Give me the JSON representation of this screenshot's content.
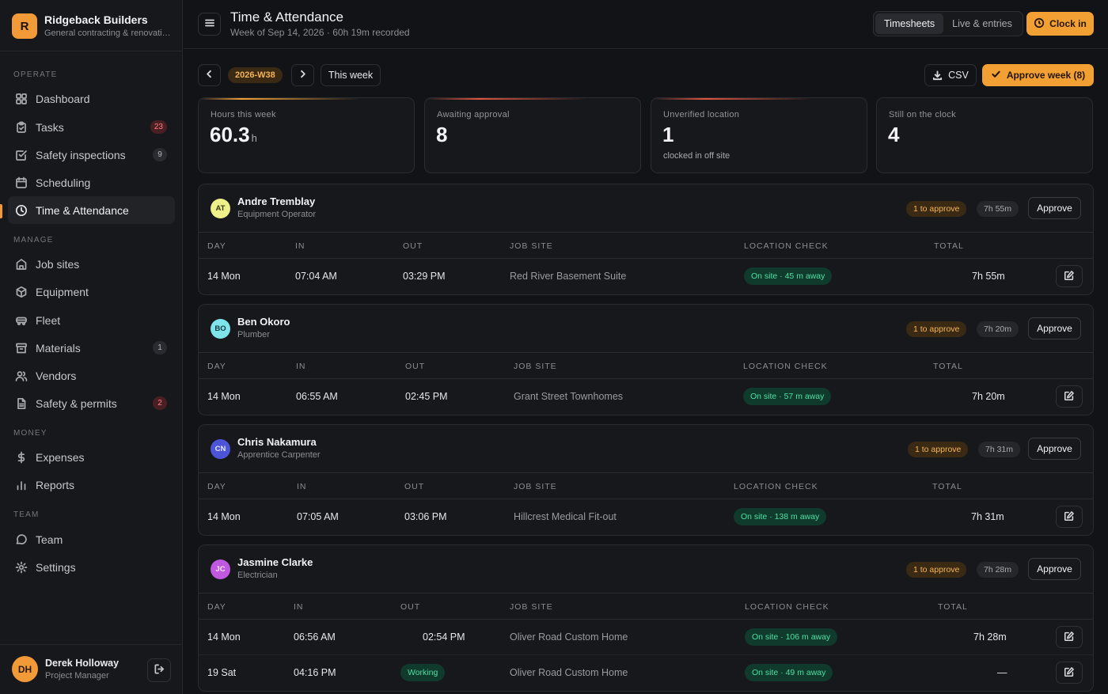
{
  "brand": {
    "logo_letter": "R",
    "name": "Ridgeback Builders",
    "subtitle": "General contracting & renovation"
  },
  "sidebar": {
    "sections": {
      "operate": "OPERATE",
      "manage": "MANAGE",
      "money": "MONEY",
      "team": "TEAM"
    },
    "items": {
      "dashboard": {
        "label": "Dashboard",
        "icon": "grid-icon"
      },
      "tasks": {
        "label": "Tasks",
        "icon": "clipboard-icon",
        "badge": "23"
      },
      "safety_inspections": {
        "label": "Safety inspections",
        "icon": "checkbox-icon",
        "badge": "9"
      },
      "scheduling": {
        "label": "Scheduling",
        "icon": "calendar-icon"
      },
      "time_attendance": {
        "label": "Time & Attendance",
        "icon": "clock-icon"
      },
      "job_sites": {
        "label": "Job sites",
        "icon": "building-icon"
      },
      "equipment": {
        "label": "Equipment",
        "icon": "box-icon"
      },
      "fleet": {
        "label": "Fleet",
        "icon": "truck-icon"
      },
      "materials": {
        "label": "Materials",
        "icon": "archive-icon",
        "badge": "1"
      },
      "vendors": {
        "label": "Vendors",
        "icon": "users-icon"
      },
      "safety_permits": {
        "label": "Safety & permits",
        "icon": "document-icon",
        "badge": "2"
      },
      "expenses": {
        "label": "Expenses",
        "icon": "dollar-icon"
      },
      "reports": {
        "label": "Reports",
        "icon": "bar-chart-icon"
      },
      "team": {
        "label": "Team",
        "icon": "chat-icon"
      },
      "settings": {
        "label": "Settings",
        "icon": "gear-icon"
      }
    },
    "active": "time_attendance"
  },
  "user": {
    "initials": "DH",
    "name": "Derek Holloway",
    "role": "Project Manager"
  },
  "header": {
    "title": "Time & Attendance",
    "subtitle": "Week of Sep 14, 2026 · 60h 19m recorded",
    "tabs": {
      "timesheets": "Timesheets",
      "live": "Live & entries"
    },
    "active_tab": "timesheets",
    "clock_in": "Clock in"
  },
  "toolbar": {
    "week": "2026-W38",
    "this_week": "This week",
    "csv": "CSV",
    "approve_week": "Approve week (8)"
  },
  "stats": {
    "hours": {
      "label": "Hours this week",
      "value": "60.3",
      "unit": "h",
      "accent": "#f2a033"
    },
    "awaiting": {
      "label": "Awaiting approval",
      "value": "8",
      "accent": "#e0553f"
    },
    "unverified": {
      "label": "Unverified location",
      "value": "1",
      "note": "clocked in off site",
      "accent": "#e0553f"
    },
    "clock": {
      "label": "Still on the clock",
      "value": "4",
      "accent": "#2b2c31"
    }
  },
  "columns": {
    "day": "DAY",
    "in": "IN",
    "out": "OUT",
    "job_site": "JOB SITE",
    "location": "LOCATION CHECK",
    "total": "TOTAL"
  },
  "employees": [
    {
      "initials": "AT",
      "name": "Andre Tremblay",
      "role": "Equipment Operator",
      "avatar_bg": "#eef08a",
      "avatar_fg": "#3a3a10",
      "to_approve": "1 to approve",
      "hours": "7h 55m",
      "approve": "Approve",
      "entries": [
        {
          "day": "14 Mon",
          "in": "07:04 AM",
          "out": "03:29 PM",
          "site": "Red River Basement Suite",
          "location": "On site · 45 m away",
          "total": "7h 55m"
        }
      ]
    },
    {
      "initials": "BO",
      "name": "Ben Okoro",
      "role": "Plumber",
      "avatar_bg": "#7ee3ea",
      "avatar_fg": "#0d3a3e",
      "to_approve": "1 to approve",
      "hours": "7h 20m",
      "approve": "Approve",
      "entries": [
        {
          "day": "14 Mon",
          "in": "06:55 AM",
          "out": "02:45 PM",
          "site": "Grant Street Townhomes",
          "location": "On site · 57 m away",
          "total": "7h 20m"
        }
      ]
    },
    {
      "initials": "CN",
      "name": "Chris Nakamura",
      "role": "Apprentice Carpenter",
      "avatar_bg": "#4c55d8",
      "avatar_fg": "#e6e8ff",
      "to_approve": "1 to approve",
      "hours": "7h 31m",
      "approve": "Approve",
      "entries": [
        {
          "day": "14 Mon",
          "in": "07:05 AM",
          "out": "03:06 PM",
          "site": "Hillcrest Medical Fit-out",
          "location": "On site · 138 m away",
          "total": "7h 31m"
        }
      ]
    },
    {
      "initials": "JC",
      "name": "Jasmine Clarke",
      "role": "Electrician",
      "avatar_bg": "#c159e0",
      "avatar_fg": "#f6e6fb",
      "to_approve": "1 to approve",
      "hours": "7h 28m",
      "approve": "Approve",
      "entries": [
        {
          "day": "14 Mon",
          "in": "06:56 AM",
          "out": "02:54 PM",
          "site": "Oliver Road Custom Home",
          "location": "On site · 106 m away",
          "total": "7h 28m"
        },
        {
          "day": "19 Sat",
          "in": "04:16 PM",
          "out": "Working",
          "site": "Oliver Road Custom Home",
          "location": "On site · 49 m away",
          "total": "—"
        }
      ]
    }
  ]
}
